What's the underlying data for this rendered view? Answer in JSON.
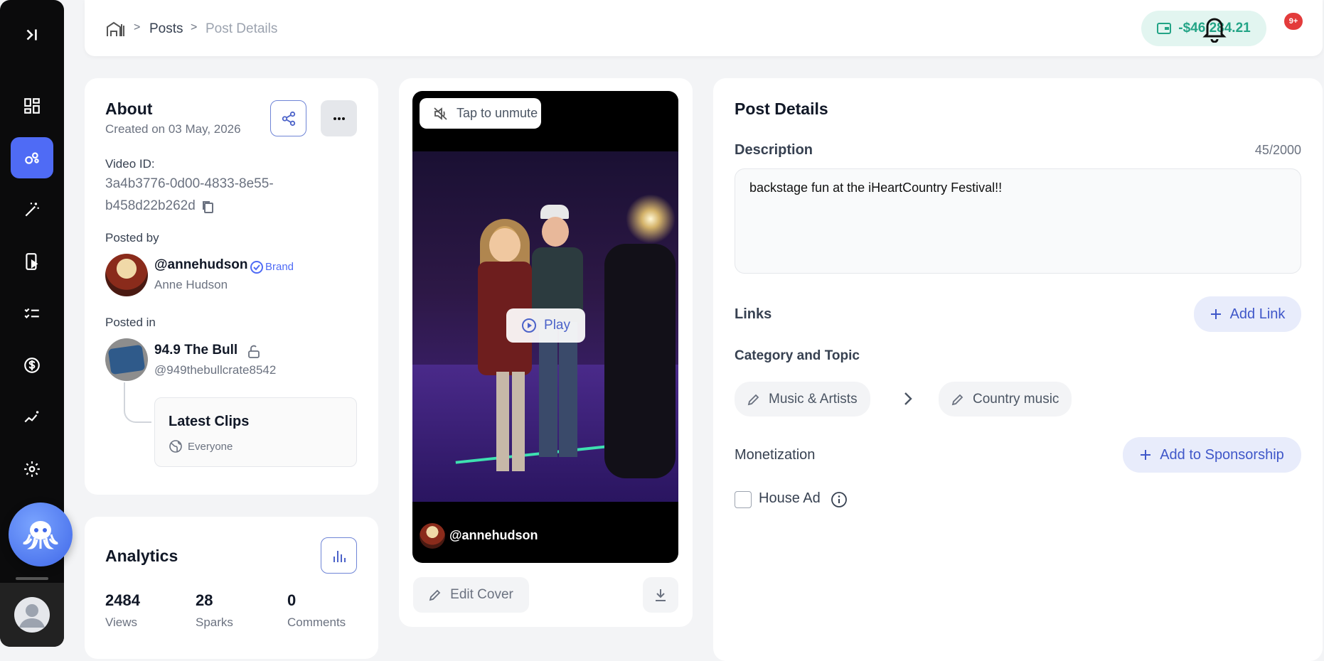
{
  "header": {
    "breadcrumb": [
      "Posts",
      "Post Details"
    ],
    "balance": "-$46,284.21",
    "notification_badge": "9+"
  },
  "about": {
    "title": "About",
    "created": "Created on 03 May, 2026",
    "video_id_label": "Video ID:",
    "video_id_line1": "3a4b3776-0d00-4833-8e55-",
    "video_id_line2": "b458d22b262d",
    "posted_by_label": "Posted by",
    "handle": "@annehudson",
    "brand_label": "Brand",
    "name": "Anne Hudson",
    "posted_in_label": "Posted in",
    "channel_name": "94.9 The Bull",
    "channel_handle": "@949thebullcrate8542",
    "playlist_title": "Latest Clips",
    "playlist_visibility": "Everyone"
  },
  "analytics": {
    "title": "Analytics",
    "stats": [
      {
        "value": "2484",
        "label": "Views"
      },
      {
        "value": "28",
        "label": "Sparks"
      },
      {
        "value": "0",
        "label": "Comments"
      }
    ]
  },
  "video": {
    "unmute_label": "Tap to unmute",
    "play_label": "Play",
    "overlay_handle": "@annehudson",
    "edit_cover_label": "Edit Cover"
  },
  "details": {
    "title": "Post Details",
    "description_label": "Description",
    "char_count": "45/2000",
    "description_text": "backstage fun at the iHeartCountry Festival!!",
    "links_label": "Links",
    "add_link_label": "Add Link",
    "category_label": "Category and Topic",
    "category": "Music & Artists",
    "topic": "Country music",
    "monetization_label": "Monetization",
    "add_sponsorship_label": "Add to Sponsorship",
    "house_ad_label": "House Ad"
  },
  "colors": {
    "accent": "#4f6bf5",
    "balance_green": "#23a486",
    "sidebar_bg": "#0b0b0c"
  }
}
